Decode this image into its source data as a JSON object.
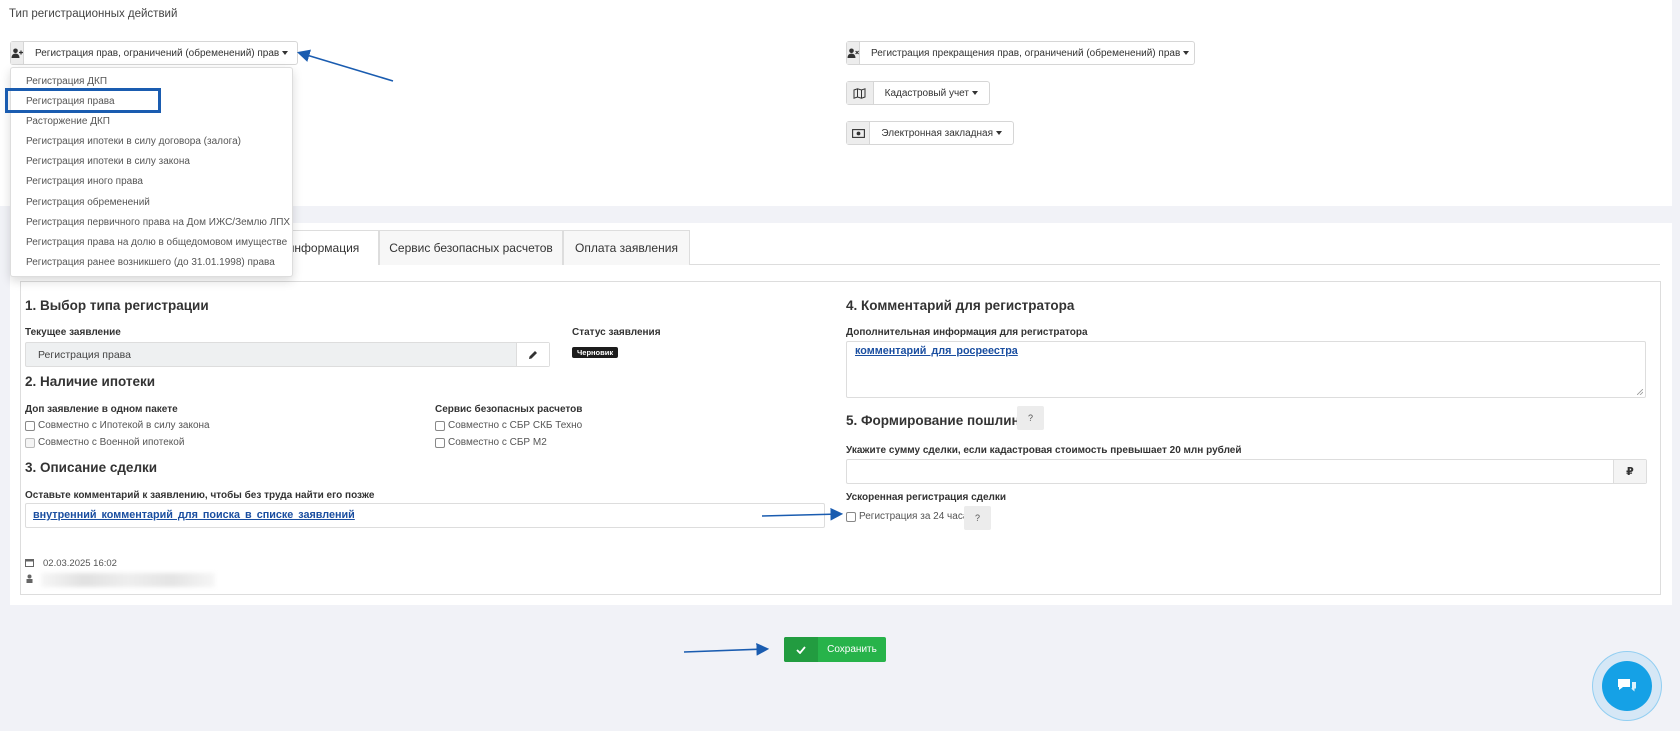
{
  "top": {
    "section_title": "Тип регистрационных действий",
    "btn_rights": "Регистрация прав, ограничений (обременений) прав",
    "btn_termination": "Регистрация прекращения прав, ограничений (обременений) прав",
    "btn_cadastre": "Кадастровый учет",
    "btn_mortgage": "Электронная закладная"
  },
  "dropdown": {
    "items": [
      "Регистрация ДКП",
      "Регистрация права",
      "Расторжение ДКП",
      "Регистрация ипотеки в силу договора (залога)",
      "Регистрация ипотеки в силу закона",
      "Регистрация иного права",
      "Регистрация обременений",
      "Регистрация первичного права на Дом ИЖС/Землю ЛПХ",
      "Регистрация права на долю в общедомовом имуществе",
      "Регистрация ранее возникшего (до 31.01.1998) права"
    ],
    "selected_index": 1
  },
  "tabs": [
    "информация",
    "Сервис безопасных расчетов",
    "Оплата заявления"
  ],
  "form": {
    "s1_title": "1. Выбор типа регистрации",
    "current_label": "Текущее заявление",
    "current_value": "Регистрация права",
    "status_label": "Статус заявления",
    "status_badge": "Черновик",
    "s2_title": "2. Наличие ипотеки",
    "pkg_label": "Доп заявление в одном пакете",
    "cb_ipoteka": "Совместно с Ипотекой в силу закона",
    "cb_military": "Совместно с Военной ипотекой",
    "sbr_label": "Сервис безопасных расчетов",
    "cb_skb": "Совместно с СБР СКБ Техно",
    "cb_m2": "Совместно с СБР М2",
    "s3_title": "3. Описание сделки",
    "desc_hint": "Оставьте комментарий к заявлению, чтобы без труда найти его позже",
    "desc_value": "внутренний комментарий для поиска в списке заявлений",
    "date": "02.03.2025 16:02",
    "s4_title": "4. Комментарий для регистратора",
    "extra_label": "Дополнительная информация для регистратора",
    "extra_value": "комментарий для росреестра",
    "s5_title": "5. Формирование пошлины",
    "help_mark": "?",
    "amount_label": "Укажите сумму сделки, если кадастровая стоимость превышает 20 млн рублей",
    "currency": "₽",
    "speed_label": "Ускоренная регистрация сделки",
    "cb_24h": "Регистрация за 24 часа"
  },
  "save_label": "Сохранить",
  "colors": {
    "accent_blue": "#1a5cb0",
    "save_green": "#27b34a",
    "chat_blue": "#15a1e6",
    "link_blue": "#1a4ea0"
  }
}
